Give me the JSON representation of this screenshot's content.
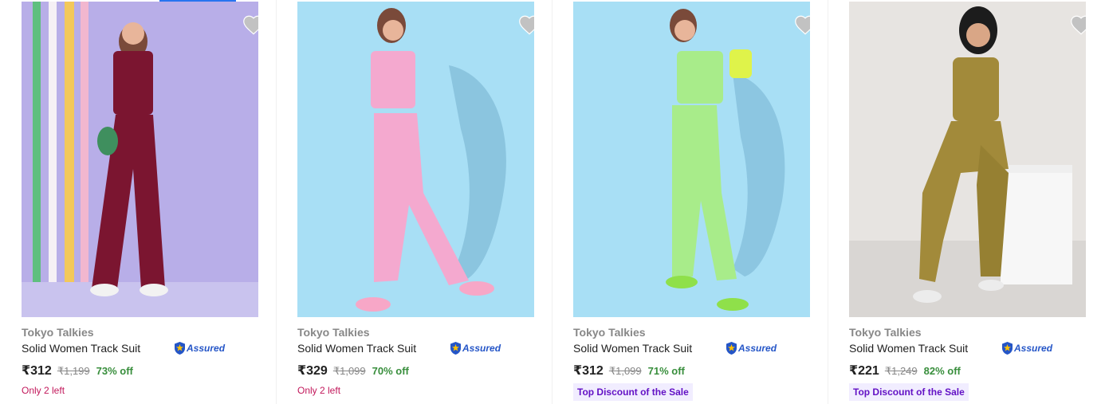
{
  "products": [
    {
      "brand": "Tokyo Talkies",
      "title": "Solid Women Track Suit",
      "assured": "Assured",
      "price": "₹312",
      "mrp": "₹1,199",
      "discount": "73% off",
      "note": "Only 2 left",
      "note_type": "stock",
      "image_bg": "#b8aee8",
      "outfit_color": "#7b1530"
    },
    {
      "brand": "Tokyo Talkies",
      "title": "Solid Women Track Suit",
      "assured": "Assured",
      "price": "₹329",
      "mrp": "₹1,099",
      "discount": "70% off",
      "note": "Only 2 left",
      "note_type": "stock",
      "image_bg": "#a8dff5",
      "outfit_color": "#f4a9cf"
    },
    {
      "brand": "Tokyo Talkies",
      "title": "Solid Women Track Suit",
      "assured": "Assured",
      "price": "₹312",
      "mrp": "₹1,099",
      "discount": "71% off",
      "note": "Top Discount of the Sale",
      "note_type": "promo",
      "image_bg": "#a8dff5",
      "outfit_color": "#a8ec8a"
    },
    {
      "brand": "Tokyo Talkies",
      "title": "Solid Women Track Suit",
      "assured": "Assured",
      "price": "₹221",
      "mrp": "₹1,249",
      "discount": "82% off",
      "note": "Top Discount of the Sale",
      "note_type": "promo",
      "image_bg": "#e7e4e1",
      "outfit_color": "#a28a3a"
    }
  ],
  "icons": {
    "wishlist": "heart-icon",
    "assured": "assured-shield-icon"
  },
  "colors": {
    "accent": "#2874f0",
    "discount": "#388e3c",
    "stock": "#c2185b",
    "promo_text": "#6312c5",
    "promo_bg": "#f1edff"
  }
}
